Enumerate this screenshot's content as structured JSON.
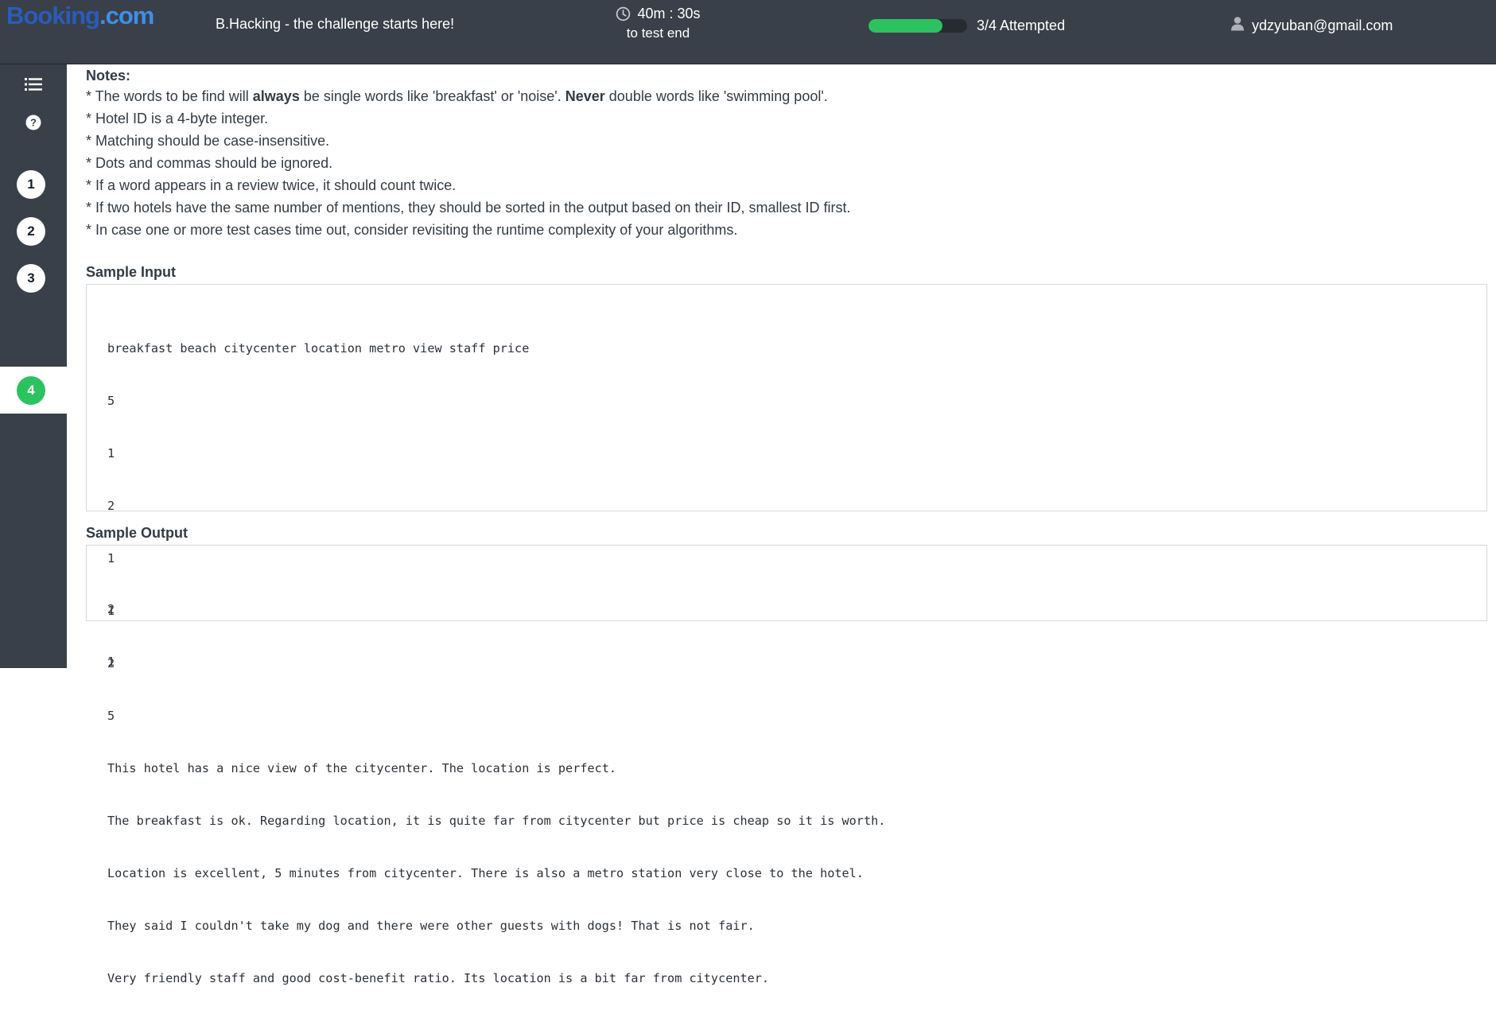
{
  "header": {
    "logo_main": "Booking",
    "logo_suffix": ".com",
    "challenge_title": "B.Hacking - the challenge starts here!",
    "timer_value": "40m : 30s",
    "timer_caption": "to test end",
    "progress_fraction": 0.75,
    "progress_label": "3/4 Attempted",
    "user_email": "ydzyuban@gmail.com"
  },
  "sidebar": {
    "icons": [
      "list-icon",
      "help-icon"
    ],
    "steps": [
      {
        "label": "1",
        "active": false
      },
      {
        "label": "2",
        "active": false
      },
      {
        "label": "3",
        "active": false
      },
      {
        "label": "4",
        "active": true
      }
    ]
  },
  "notes": {
    "title": "Notes:",
    "line1_a": "* The words to be find will ",
    "line1_b": "always",
    "line1_c": " be single words like 'breakfast' or 'noise'. ",
    "line1_d": "Never",
    "line1_e": " double words like 'swimming pool'.",
    "lines": [
      "* Hotel ID is a 4-byte integer.",
      "* Matching should be case-insensitive.",
      "* Dots and commas should be ignored.",
      "* If a word appears in a review twice, it should count twice.",
      "* If two hotels have the same number of mentions, they should be sorted in the output based on their ID, smallest ID first.",
      "* In case one or more test cases time out, consider revisiting the runtime complexity of your algorithms."
    ]
  },
  "sample_input": {
    "title": "Sample Input",
    "lines": [
      "breakfast beach citycenter location metro view staff price",
      "5",
      "1",
      "2",
      "1",
      "1",
      "2",
      "5",
      "This hotel has a nice view of the citycenter. The location is perfect.",
      "The breakfast is ok. Regarding location, it is quite far from citycenter but price is cheap so it is worth.",
      "Location is excellent, 5 minutes from citycenter. There is also a metro station very close to the hotel.",
      "They said I couldn't take my dog and there were other guests with dogs! That is not fair.",
      "Very friendly staff and good cost-benefit ratio. Its location is a bit far from citycenter."
    ]
  },
  "sample_output": {
    "title": "Sample Output",
    "lines": [
      "2",
      "1"
    ]
  },
  "colors": {
    "topbar": "#394049",
    "accent_green": "#2cc260",
    "logo_blue": "#2a5cb8"
  }
}
